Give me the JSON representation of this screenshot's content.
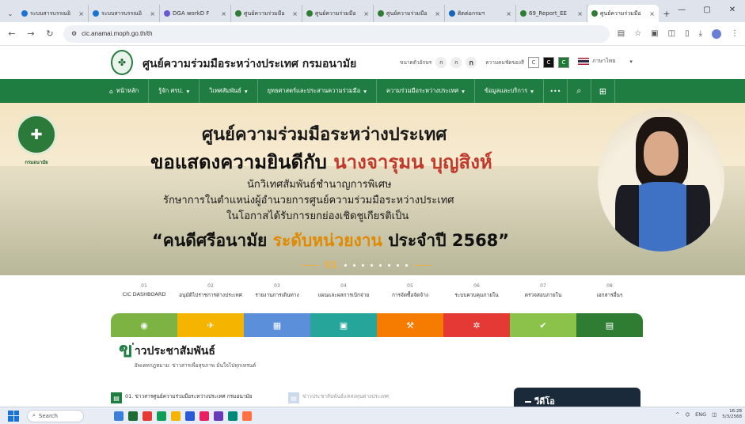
{
  "browser": {
    "tabs": [
      {
        "title": "ระบบสารบรรณอิ",
        "fav": "#1a73d8",
        "active": false
      },
      {
        "title": "ระบบสารบรรณอิ",
        "fav": "#1a73d8",
        "active": false
      },
      {
        "title": "DGA workD F",
        "fav": "#6b5ad6",
        "active": false
      },
      {
        "title": "ศูนย์ความร่วมมือ",
        "fav": "#2e7d32",
        "active": false
      },
      {
        "title": "ศูนย์ความร่วมมือ",
        "fav": "#2e7d32",
        "active": false
      },
      {
        "title": "ศูนย์ความร่วมมือ",
        "fav": "#2e7d32",
        "active": false
      },
      {
        "title": "ติดต่อกรมฯ",
        "fav": "#1565c0",
        "active": false
      },
      {
        "title": "69_Report_EE",
        "fav": "#2e7d32",
        "active": false
      },
      {
        "title": "ศูนย์ความร่วมมือ",
        "fav": "#2e7d32",
        "active": true
      }
    ],
    "url": "cic.anamai.moph.go.th/th",
    "new_tab": "+",
    "close_glyph": "×"
  },
  "site": {
    "title": "ศูนย์ความร่วมมือระหว่างประเทศ กรมอนามัย",
    "font_size_label": "ขนาดตัวอักษร",
    "font_small": "ก",
    "font_medium": "ก",
    "font_large": "ก",
    "contrast_label": "ความคมชัดของสี",
    "contrast_c1": "C",
    "contrast_c2": "C",
    "contrast_c3": "C",
    "language": "ภาษาไทย"
  },
  "nav": {
    "items": [
      {
        "label": "หน้าหลัก",
        "name": "nav-home"
      },
      {
        "label": "รู้จัก ศรป.",
        "name": "nav-about"
      },
      {
        "label": "วิเทศสัมพันธ์",
        "name": "nav-foreign-relations"
      },
      {
        "label": "ยุทธศาสตร์และประสานความร่วมมือ",
        "name": "nav-strategy"
      },
      {
        "label": "ความร่วมมือระหว่างประเทศ",
        "name": "nav-cooperation"
      },
      {
        "label": "ข้อมูลและบริการ",
        "name": "nav-services"
      }
    ],
    "more": "•••"
  },
  "banner": {
    "seal_label": "กรมอนามัย",
    "heading": "ศูนย์ความร่วมมือระหว่างประเทศ",
    "congrats_prefix": "ขอแสดงความยินดีกับ",
    "name": "นางจารุมน บุญสิงห์",
    "position": "นักวิเทศสัมพันธ์ชำนาญการพิเศษ",
    "acting": "รักษาการในตำแหน่งผู้อำนวยการศูนย์ความร่วมมือระหว่างประเทศ",
    "occasion": "ในโอกาสได้รับการยกย่องเชิดชูเกียรติเป็น",
    "award_prefix": "“คนดีศรีอนามัย",
    "award_level": "ระดับหน่วยงาน",
    "award_suffix": "ประจำปี 2568”",
    "slide_number": "01"
  },
  "quick_links": [
    {
      "num": "01",
      "label": "CIC DASHBOARD",
      "color": "#7cb342",
      "icon": "dashboard-icon",
      "glyph": "◉"
    },
    {
      "num": "02",
      "label": "อนุมัติไปราชการต่างประเทศ",
      "color": "#f4b400",
      "icon": "airplane-icon",
      "glyph": "✈"
    },
    {
      "num": "03",
      "label": "รายงานการเดินทาง",
      "color": "#5b8fd9",
      "icon": "calendar-icon",
      "glyph": "▦"
    },
    {
      "num": "04",
      "label": "แผนและผลการเบิกจ่าย",
      "color": "#26a69a",
      "icon": "money-icon",
      "glyph": "▣"
    },
    {
      "num": "05",
      "label": "การจัดซื้อจัดจ้าง",
      "color": "#f57c00",
      "icon": "gavel-icon",
      "glyph": "⚒"
    },
    {
      "num": "06",
      "label": "ระบบควบคุมภายใน",
      "color": "#e53935",
      "icon": "gear-icon",
      "glyph": "✲"
    },
    {
      "num": "07",
      "label": "ตรวจสอบภายใน",
      "color": "#8bc34a",
      "icon": "clipboard-icon",
      "glyph": "✔"
    },
    {
      "num": "08",
      "label": "เอกสารอื่นๆ",
      "color": "#2e7d32",
      "icon": "document-icon",
      "glyph": "▤"
    }
  ],
  "news": {
    "initial": "ข",
    "title": "่าวประชาสัมพันธ์",
    "subtitle": "อัพเดทกฎหมาย: ข่าวสารเพื่อสุขภาพ มั่นใจไปทุกเทรนด์",
    "items": [
      "01. ข่าวสารศูนย์ความร่วมมือระหว่างประเทศ กรมอนามัย",
      "ข่าวประชาสัมพันธ์แหล่งทุนต่างประเทศ"
    ],
    "video_label": "วีดีโอ"
  },
  "taskbar": {
    "search_label": "Search",
    "apps": [
      "#3b7fd8",
      "#1e6b33",
      "#e53935",
      "#0f9d58",
      "#f4b400",
      "#2b5ad6",
      "#e91e63",
      "#673ab7",
      "#00897b",
      "#ff7043"
    ],
    "lang": "ENG",
    "time": "16:28",
    "date": "5/3/2568"
  }
}
